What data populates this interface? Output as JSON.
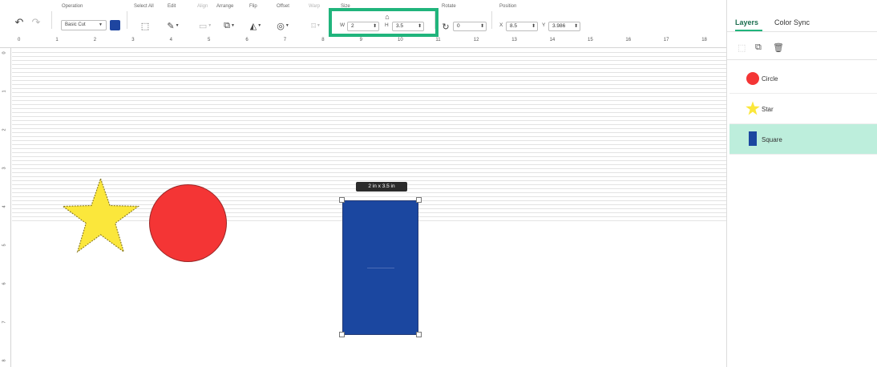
{
  "toolbar": {
    "undo_icon": "undo-icon",
    "redo_icon": "redo-icon",
    "operation": {
      "label": "Operation",
      "value": "Basic Cut",
      "color": "#1e45a0"
    },
    "select_all_label": "Select All",
    "edit_label": "Edit",
    "align_label": "Align",
    "arrange_label": "Arrange",
    "flip_label": "Flip",
    "offset_label": "Offset",
    "warp_label": "Warp",
    "size": {
      "label": "Size",
      "w_prefix": "W",
      "w_value": "2",
      "h_prefix": "H",
      "h_value": "3.5",
      "lock_icon": "lock-icon"
    },
    "rotate": {
      "label": "Rotate",
      "value": "0"
    },
    "position": {
      "label": "Position",
      "x_prefix": "X",
      "x_value": "8.5",
      "y_prefix": "Y",
      "y_value": "3.986"
    },
    "highlight_color": "#20b47c"
  },
  "ruler": {
    "h_numbers": [
      "0",
      "1",
      "2",
      "3",
      "4",
      "5",
      "6",
      "7",
      "8",
      "9",
      "10",
      "11",
      "12",
      "13",
      "14",
      "15",
      "16",
      "17",
      "18"
    ],
    "v_numbers": [
      "0",
      "1",
      "2",
      "3",
      "4",
      "5",
      "6",
      "7",
      "8"
    ]
  },
  "canvas": {
    "size_tooltip": "2 in x 3.5 in",
    "colors": {
      "square": "#1b47a0",
      "circle": "#f43535",
      "star": "#fbe73b"
    }
  },
  "panel": {
    "tabs": [
      {
        "label": "Layers",
        "active": true
      },
      {
        "label": "Color Sync",
        "active": false
      }
    ],
    "actions": [
      "ungroup-icon",
      "duplicate-icon",
      "delete-icon"
    ],
    "layers": [
      {
        "name": "Circle",
        "shape": "circle",
        "selected": false
      },
      {
        "name": "Star",
        "shape": "star",
        "selected": false
      },
      {
        "name": "Square",
        "shape": "square",
        "selected": true
      }
    ]
  }
}
